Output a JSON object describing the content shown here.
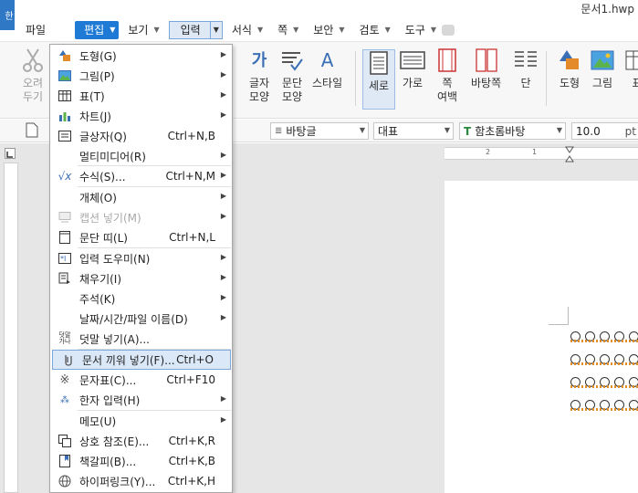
{
  "app_badge": "한",
  "window_title": "문서1.hwp",
  "menubar": {
    "file": "파일",
    "edit": "편집",
    "view": "보기",
    "input": "입력",
    "format": "서식",
    "page": "쪽",
    "security": "보안",
    "review": "검토",
    "tools": "도구"
  },
  "ribbon": {
    "cut_line1": "오려",
    "cut_line2": "두기",
    "char_shape_line1": "글자",
    "char_shape_line2": "모양",
    "para_shape_line1": "문단",
    "para_shape_line2": "모양",
    "style": "스타일",
    "vertical": "세로",
    "horizontal": "가로",
    "page_margin_line1": "쪽",
    "page_margin_line2": "여백",
    "master_page": "바탕쪽",
    "columns": "단",
    "shape": "도형",
    "picture": "그림",
    "table_partial": "표"
  },
  "formatbar": {
    "style_value": "바탕글",
    "lang_value": "대표",
    "font_value": "함초롬바탕",
    "size_value": "10.0",
    "unit_partial": "pt"
  },
  "ruler": {
    "h_tick1": "2",
    "h_tick2": "1"
  },
  "dropdown": {
    "items": [
      {
        "label": "도형(G)",
        "shortcut": "",
        "submenu": true,
        "disabled": false
      },
      {
        "label": "그림(P)",
        "shortcut": "",
        "submenu": true,
        "disabled": false
      },
      {
        "label": "표(T)",
        "shortcut": "",
        "submenu": true,
        "disabled": false
      },
      {
        "label": "차트(J)",
        "shortcut": "",
        "submenu": true,
        "disabled": false
      },
      {
        "label": "글상자(Q)",
        "shortcut": "Ctrl+N,B",
        "submenu": false,
        "disabled": false
      },
      {
        "label": "멀티미디어(R)",
        "shortcut": "",
        "submenu": true,
        "disabled": false
      },
      {
        "label": "수식(S)...",
        "shortcut": "Ctrl+N,M",
        "submenu": true,
        "disabled": false
      },
      {
        "label": "개체(O)",
        "shortcut": "",
        "submenu": true,
        "disabled": false
      },
      {
        "label": "캡션 넣기(M)",
        "shortcut": "",
        "submenu": true,
        "disabled": true
      },
      {
        "label": "문단 띠(L)",
        "shortcut": "Ctrl+N,L",
        "submenu": false,
        "disabled": false
      },
      {
        "label": "입력 도우미(N)",
        "shortcut": "",
        "submenu": true,
        "disabled": false
      },
      {
        "label": "채우기(I)",
        "shortcut": "",
        "submenu": true,
        "disabled": false
      },
      {
        "label": "주석(K)",
        "shortcut": "",
        "submenu": true,
        "disabled": false
      },
      {
        "label": "날짜/시간/파일 이름(D)",
        "shortcut": "",
        "submenu": true,
        "disabled": false
      },
      {
        "label": "덧말 넣기(A)...",
        "shortcut": "",
        "submenu": false,
        "disabled": false
      },
      {
        "label": "문서 끼워 넣기(F)...",
        "shortcut": "Ctrl+O",
        "submenu": false,
        "disabled": false
      },
      {
        "label": "문자표(C)...",
        "shortcut": "Ctrl+F10",
        "submenu": false,
        "disabled": false
      },
      {
        "label": "한자 입력(H)",
        "shortcut": "",
        "submenu": true,
        "disabled": false
      },
      {
        "label": "메모(U)",
        "shortcut": "",
        "submenu": true,
        "disabled": false
      },
      {
        "label": "상호 참조(E)...",
        "shortcut": "Ctrl+K,R",
        "submenu": false,
        "disabled": false
      },
      {
        "label": "책갈피(B)...",
        "shortcut": "Ctrl+K,B",
        "submenu": false,
        "disabled": false
      },
      {
        "label": "하이퍼링크(Y)...",
        "shortcut": "Ctrl+K,H",
        "submenu": false,
        "disabled": false
      }
    ],
    "highlighted_index": 15,
    "icon_names": [
      "shape-icon",
      "picture-icon",
      "table-icon",
      "chart-icon",
      "textbox-icon",
      "",
      "equation-icon",
      "",
      "caption-icon",
      "paragraph-band-icon",
      "input-helper-icon",
      "fill-icon",
      "",
      "",
      "ruby-text-icon",
      "insert-document-icon",
      "symbol-icon",
      "hanja-icon",
      "",
      "cross-reference-icon",
      "bookmark-icon",
      "hyperlink-icon"
    ]
  },
  "colors": {
    "accent": "#1f7ad6",
    "highlight_bg": "#dbe8f8",
    "highlight_border": "#7aa6da"
  }
}
